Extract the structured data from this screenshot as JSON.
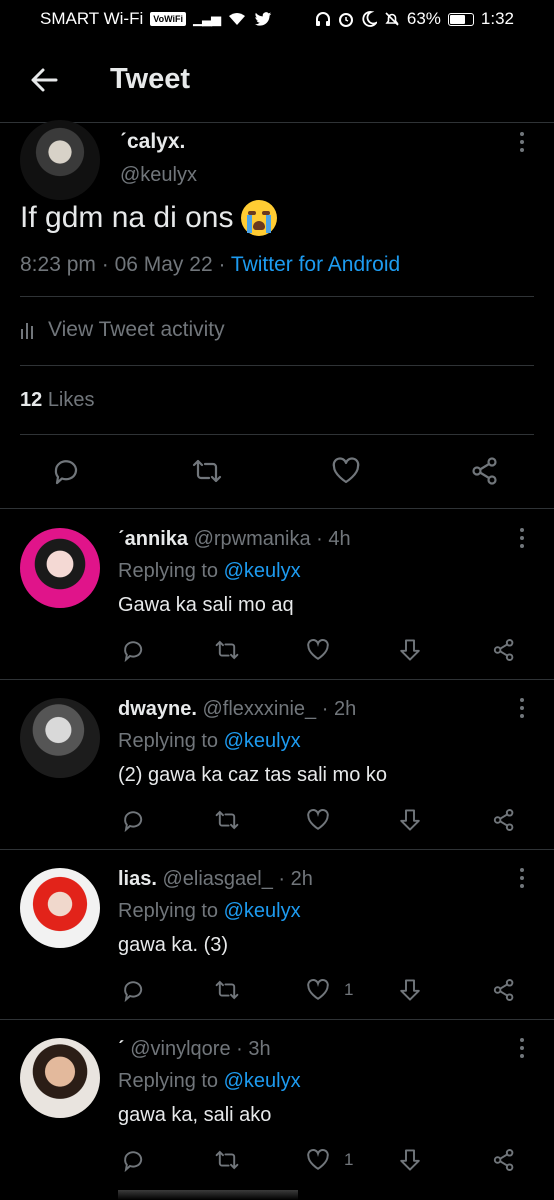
{
  "status_bar": {
    "carrier": "SMART Wi-Fi",
    "vowifi": "VoWiFi",
    "battery": "63%",
    "battery_level": 0.63,
    "time": "1:32"
  },
  "header": {
    "title": "Tweet"
  },
  "tweet": {
    "name": "ˊcalyx.",
    "handle": "@keulyx",
    "text": "If gdm na di ons",
    "emoji": "loudly-crying-face",
    "time": "8:23 pm",
    "date": "06 May 22",
    "source": "Twitter for Android",
    "activity_label": "View Tweet activity",
    "likes_count": "12",
    "likes_label": "Likes"
  },
  "replies": [
    {
      "name": "ˊannika",
      "handle": "@rpwmanika",
      "age": "4h",
      "replying_prefix": "Replying to",
      "replying_to": "@keulyx",
      "text": "Gawa ka sali mo aq",
      "like_count": ""
    },
    {
      "name": "dwayne.",
      "handle": "@flexxxinie_",
      "age": "2h",
      "replying_prefix": "Replying to",
      "replying_to": "@keulyx",
      "text": "(2) gawa ka caz tas sali mo ko",
      "like_count": ""
    },
    {
      "name": "lias.",
      "handle": "@eliasgael_",
      "age": "2h",
      "replying_prefix": "Replying to",
      "replying_to": "@keulyx",
      "text": "gawa ka. (3)",
      "like_count": "1"
    },
    {
      "name": "ˊ",
      "handle": "@vinylqore",
      "age": "3h",
      "replying_prefix": "Replying to",
      "replying_to": "@keulyx",
      "text": "gawa ka, sali ako",
      "like_count": "1"
    }
  ],
  "colors": {
    "background": "#000000",
    "accent": "#1d9bf0",
    "muted": "#71767b",
    "text": "#e7e9ea"
  }
}
